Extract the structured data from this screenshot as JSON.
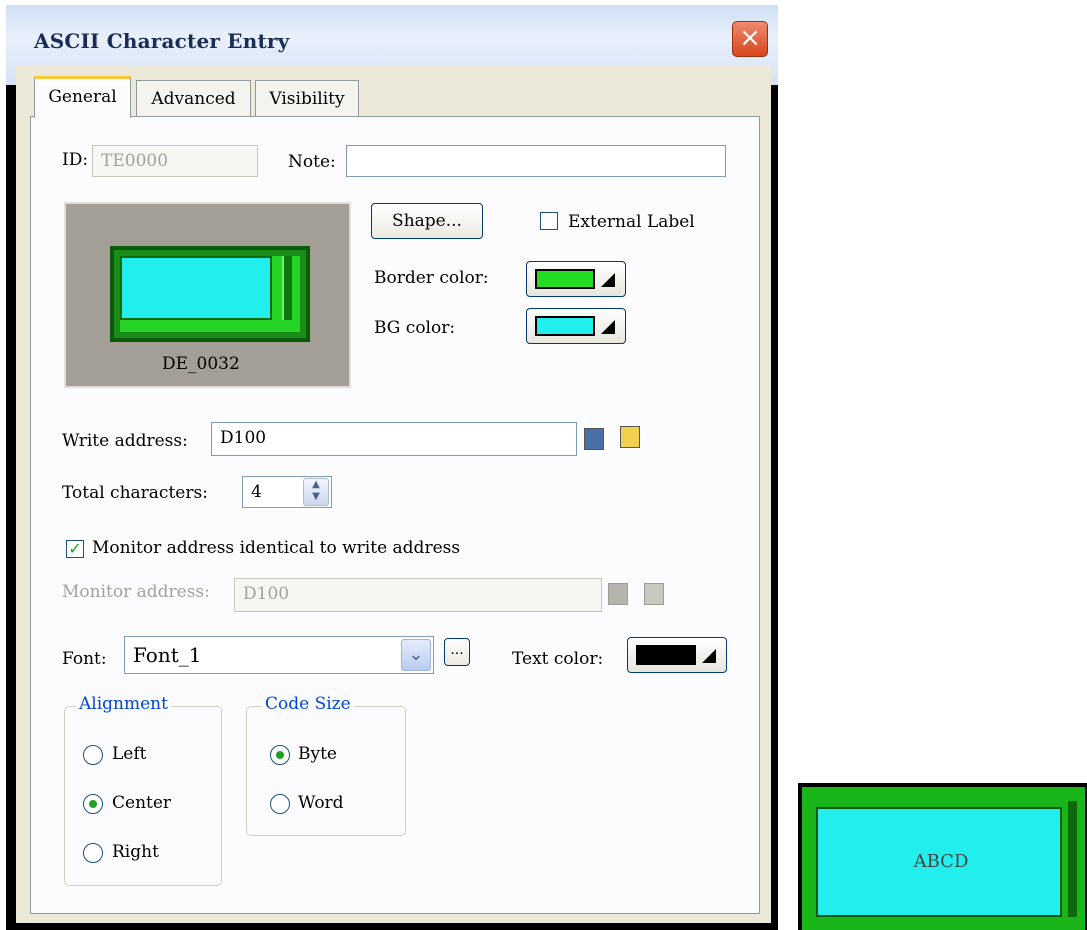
{
  "window": {
    "title": "ASCII Character Entry",
    "close_icon": "×"
  },
  "tabs": [
    {
      "label": "General",
      "active": true
    },
    {
      "label": "Advanced",
      "active": false
    },
    {
      "label": "Visibility",
      "active": false
    }
  ],
  "general": {
    "id_label": "ID:",
    "id_value": "TE0000",
    "note_label": "Note:",
    "note_value": "",
    "preview_caption": "DE_0032",
    "shape_button": "Shape...",
    "external_label": "External Label",
    "external_label_checked": false,
    "border_color_label": "Border color:",
    "border_color": "#22dd22",
    "bg_color_label": "BG color:",
    "bg_color": "#22eeee",
    "write_address_label": "Write address:",
    "write_address": "D100",
    "total_characters_label": "Total characters:",
    "total_characters": "4",
    "monitor_identical_label": "Monitor address identical to write address",
    "monitor_identical_checked": true,
    "monitor_address_label": "Monitor address:",
    "monitor_address": "D100",
    "font_label": "Font:",
    "font_value": "Font_1",
    "font_more_button": "...",
    "text_color_label": "Text color:",
    "text_color": "#000000"
  },
  "alignment": {
    "title": "Alignment",
    "options": [
      "Left",
      "Center",
      "Right"
    ],
    "selected": "Center"
  },
  "code_size": {
    "title": "Code Size",
    "options": [
      "Byte",
      "Word"
    ],
    "selected": "Byte"
  },
  "sample": {
    "text": "ABCD"
  }
}
